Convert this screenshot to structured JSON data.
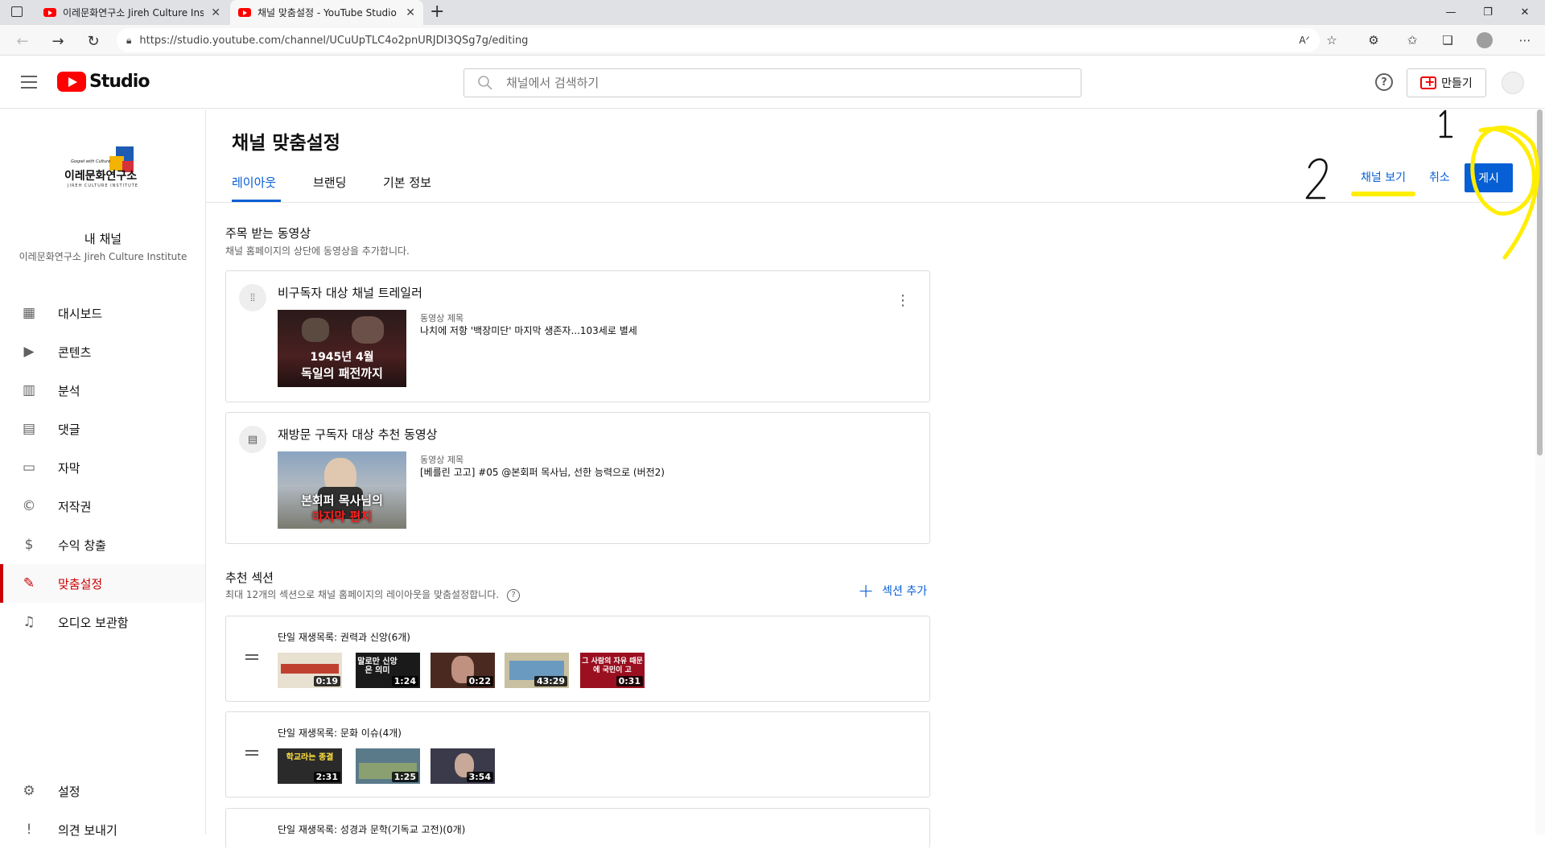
{
  "browser": {
    "tabs": [
      {
        "title": "이레문화연구소 Jireh Culture Institute",
        "active": false
      },
      {
        "title": "채널 맞춤설정 - YouTube Studio",
        "active": true
      }
    ],
    "new_tab": "+",
    "url": "https://studio.youtube.com/channel/UCuUpTLC4o2pnURJDI3QSg7g/editing",
    "window_controls": {
      "minimize": "—",
      "restore": "❐",
      "close": "✕"
    }
  },
  "header": {
    "logo_text": "Studio",
    "search_placeholder": "채널에서 검색하기",
    "help": "?",
    "create_label": "만들기"
  },
  "sidebar": {
    "logo_name": "이레문화연구소",
    "logo_tagline": "Gospel with Culture",
    "logo_sub": "JIREH CULTURE INSTITUTE",
    "my_channel": "내 채널",
    "channel_name": "이레문화연구소 Jireh Culture Institute",
    "items": [
      {
        "label": "대시보드",
        "icon": "dashboard-icon",
        "glyph": "▦"
      },
      {
        "label": "콘텐츠",
        "icon": "content-icon",
        "glyph": "▶"
      },
      {
        "label": "분석",
        "icon": "analytics-icon",
        "glyph": "▥"
      },
      {
        "label": "댓글",
        "icon": "comments-icon",
        "glyph": "▤"
      },
      {
        "label": "자막",
        "icon": "subtitles-icon",
        "glyph": "▭"
      },
      {
        "label": "저작권",
        "icon": "copyright-icon",
        "glyph": "©"
      },
      {
        "label": "수익 창출",
        "icon": "monetization-icon",
        "glyph": "$"
      },
      {
        "label": "맞춤설정",
        "icon": "customization-icon",
        "glyph": "✎",
        "active": true
      },
      {
        "label": "오디오 보관함",
        "icon": "audio-library-icon",
        "glyph": "♫"
      }
    ],
    "bottom_items": [
      {
        "label": "설정",
        "icon": "settings-icon",
        "glyph": "⚙"
      },
      {
        "label": "의견 보내기",
        "icon": "feedback-icon",
        "glyph": "!"
      }
    ]
  },
  "main": {
    "title": "채널 맞춤설정",
    "tabs": [
      "레이아웃",
      "브랜딩",
      "기본 정보"
    ],
    "active_tab": "레이아웃",
    "actions": {
      "view_channel": "채널 보기",
      "cancel": "취소",
      "publish": "게시"
    },
    "featured": {
      "title": "주목 받는 동영상",
      "description": "채널 홈페이지의 상단에 동영상을 추가합니다.",
      "cards": [
        {
          "title": "비구독자 대상 채널 트레일러",
          "meta_label": "동영상 제목",
          "video_title": "나치에 저항 '백장미단' 마지막 생존자...103세로 별세",
          "thumb_caption_1": "1945년 4월",
          "thumb_caption_2": "독일의 패전까지"
        },
        {
          "title": "재방문 구독자 대상 추천 동영상",
          "meta_label": "동영상 제목",
          "video_title": "[베를린 고고] #05 @본회퍼 목사님, 선한 능력으로 (버전2)",
          "thumb_caption_1": "본회퍼 목사님의",
          "thumb_caption_2": "마지막 편지"
        }
      ]
    },
    "sections": {
      "title": "추천 섹션",
      "description": "최대 12개의 섹션으로 채널 홈페이지의 레이아웃을 맞춤설정합니다.",
      "add_label": "섹션 추가",
      "playlists": [
        {
          "title": "단일 재생목록: 권력과 신앙(6개)",
          "videos": [
            {
              "duration": "0:19",
              "caption": "",
              "bg": "#e8e0d0"
            },
            {
              "duration": "1:24",
              "caption": "말로만 신앙은 의미",
              "bg": "#1a1a1a"
            },
            {
              "duration": "0:22",
              "caption": "",
              "bg": "#4a2a20"
            },
            {
              "duration": "43:29",
              "caption": "",
              "bg": "#c8c0a0"
            },
            {
              "duration": "0:31",
              "caption": "그 사람의 자유 때문에 국민이 고",
              "bg": "#9a1020"
            }
          ]
        },
        {
          "title": "단일 재생목록: 문화 이슈(4개)",
          "videos": [
            {
              "duration": "2:31",
              "caption": "학교라는 종결",
              "bg": "#2a2a2a"
            },
            {
              "duration": "1:25",
              "caption": "",
              "bg": "#5a7a8a"
            },
            {
              "duration": "3:54",
              "caption": "",
              "bg": "#3a3a4a"
            }
          ]
        },
        {
          "title": "단일 재생목록: 성경과 문학(기독교 고전)(0개)",
          "videos": []
        }
      ]
    }
  },
  "colors": {
    "accent": "#065fd4",
    "brand_red": "#ff0000",
    "active_nav": "#cc0000",
    "annotation": "#ffee00"
  }
}
